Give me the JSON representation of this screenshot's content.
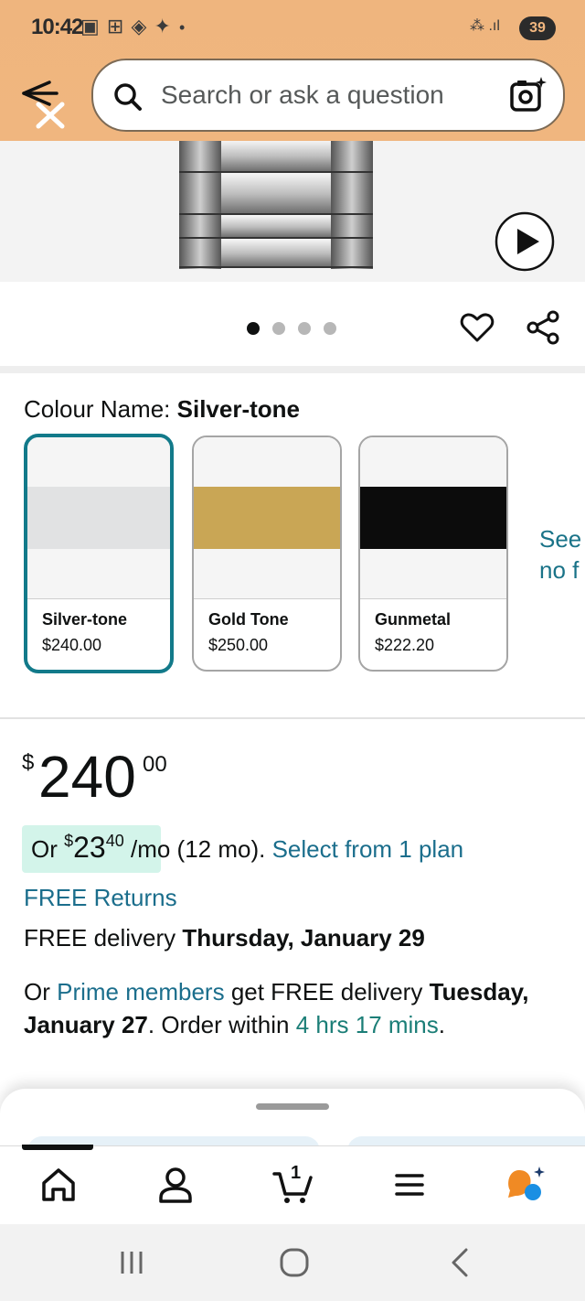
{
  "status_bar": {
    "time": "10:42",
    "notifications": "▣ ⊞ ◈ ✦",
    "dot": "•",
    "network": "⁂ .ıl",
    "battery": "39"
  },
  "header": {
    "search_placeholder": "Search or ask a question"
  },
  "carousel": {
    "dot_count": 4,
    "active_index": 0
  },
  "variations": {
    "label": "Colour Name: ",
    "selected_value": "Silver-tone",
    "options": [
      {
        "name": "Silver-tone",
        "price": "$240.00",
        "color": "#e1e2e3"
      },
      {
        "name": "Gold Tone",
        "price": "$250.00",
        "color": "#c9a655"
      },
      {
        "name": "Gunmetal",
        "price": "$222.20",
        "color": "#0c0c0c"
      }
    ],
    "see_more_line1": "See",
    "see_more_line2": "no f"
  },
  "price": {
    "currency": "$",
    "whole": "240",
    "fraction": "00"
  },
  "installment": {
    "prefix": "Or ",
    "currency": "$",
    "whole": "23",
    "fraction": "40",
    "term": " /mo (12 mo). ",
    "plan_link": "Select from 1 plan"
  },
  "delivery": {
    "free_returns": "FREE Returns",
    "free_delivery_prefix": "FREE delivery ",
    "free_delivery_date": "Thursday, January 29",
    "prime_prefix": "Or ",
    "prime_link": "Prime members",
    "prime_mid": " get FREE delivery ",
    "prime_date": "Tuesday, January 27",
    "order_within": ". Order within ",
    "countdown": "4 hrs 17 mins",
    "end": "."
  },
  "bottom_nav": {
    "cart_count": "1",
    "items": [
      "home-icon",
      "account-icon",
      "cart-icon",
      "menu-icon",
      "rufus-assistant-icon"
    ]
  },
  "colors": {
    "header_bg": "#f0b67f",
    "selected_border": "#127a8a",
    "link": "#1b6e8c",
    "installment_bg": "#d3f4ea",
    "rufus_orange": "#f08a24",
    "rufus_blue": "#1a8fe3"
  }
}
